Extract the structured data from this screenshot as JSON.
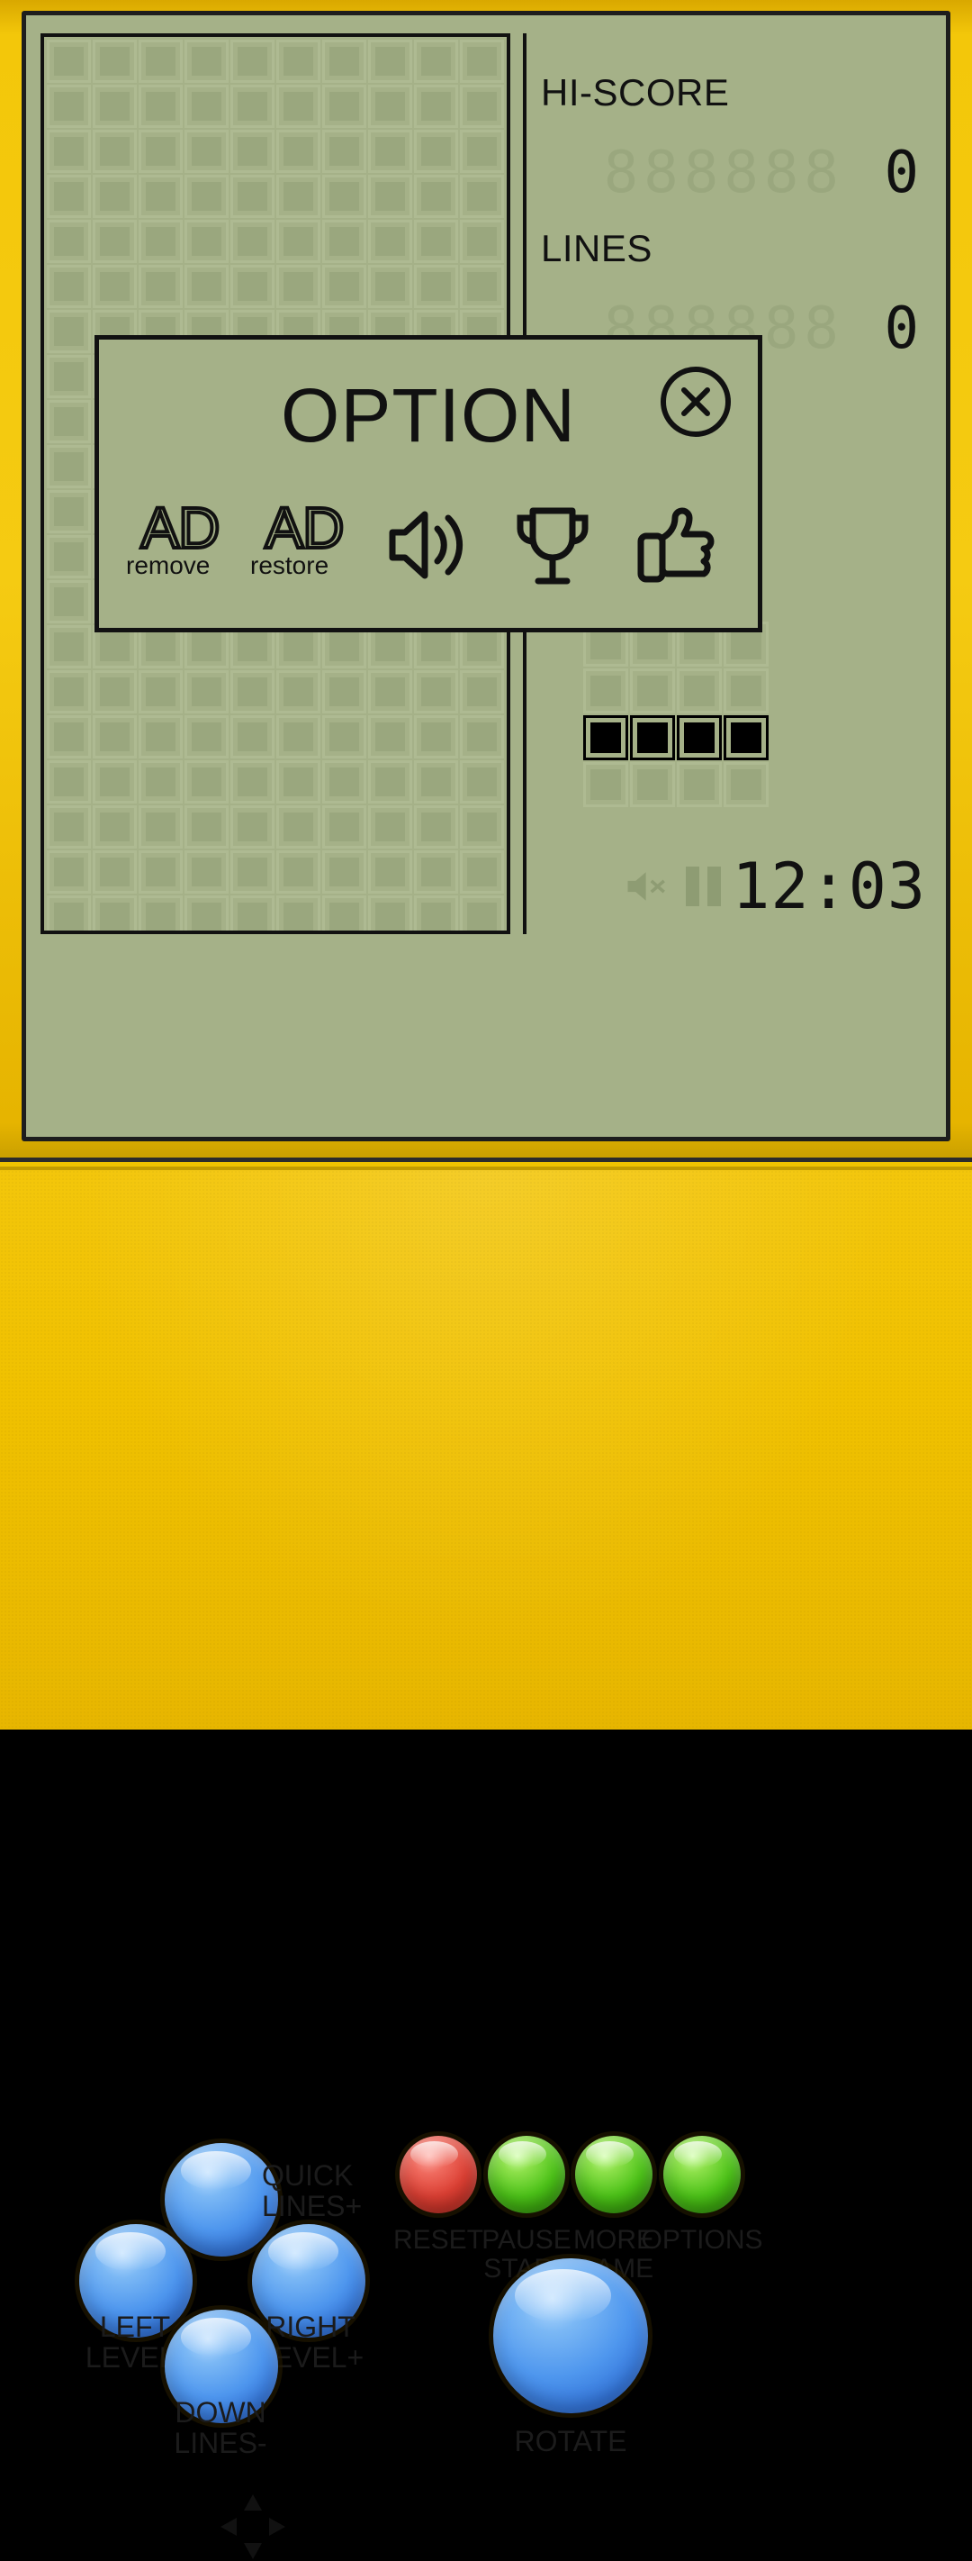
{
  "device": {
    "shell_color": "#f2c500",
    "lcd_color": "#a5b188",
    "ink_color": "#111111"
  },
  "screen": {
    "hiscore": {
      "label": "HI-SCORE",
      "ghost": "888888",
      "value": "0",
      "digits": 6
    },
    "lines": {
      "label": "LINES",
      "ghost": "888888",
      "value": "0",
      "digits": 6
    },
    "status": {
      "mute_icon": "speaker-muted-icon",
      "pause_icon": "pause-icon",
      "clock": "12:03"
    },
    "next_piece": {
      "name": "i-piece",
      "rows": 4,
      "cols": 4,
      "filled": [
        [
          0,
          0,
          0,
          0
        ],
        [
          0,
          0,
          0,
          0
        ],
        [
          1,
          1,
          1,
          1
        ],
        [
          0,
          0,
          0,
          0
        ]
      ]
    },
    "playfield": {
      "cols": 10,
      "rows": 20
    }
  },
  "dialog": {
    "title": "OPTION",
    "close_icon": "close-circle-icon",
    "options": [
      {
        "name": "ad-remove",
        "glyph": "AD",
        "caption": "remove",
        "icon": "ad-remove-icon"
      },
      {
        "name": "ad-restore",
        "glyph": "AD",
        "caption": "restore",
        "icon": "ad-restore-icon"
      },
      {
        "name": "sound",
        "glyph": "",
        "caption": "",
        "icon": "speaker-on-icon"
      },
      {
        "name": "leaderboard",
        "glyph": "",
        "caption": "",
        "icon": "trophy-icon"
      },
      {
        "name": "rate",
        "glyph": "",
        "caption": "",
        "icon": "thumbs-up-icon"
      }
    ]
  },
  "controls": {
    "dpad": {
      "up": {
        "label": "QUICK\nLINES+",
        "color": "#4f97ee"
      },
      "left": {
        "label": "LEFT\nLEVEL-",
        "color": "#4f97ee"
      },
      "right": {
        "label": "RIGHT\nLEVEL+",
        "color": "#4f97ee"
      },
      "down": {
        "label": "DOWN\nLINES-",
        "color": "#4f97ee"
      },
      "center_icon": "dpad-arrows-icon"
    },
    "buttons": [
      {
        "name": "reset",
        "label": "RESET",
        "color": "#db3f33"
      },
      {
        "name": "pause",
        "label": "PAUSE\nSTART",
        "color": "#4cc218"
      },
      {
        "name": "more",
        "label": "MORE\nGAME",
        "color": "#4cc218"
      },
      {
        "name": "options",
        "label": "OPTIONS",
        "color": "#4cc218"
      }
    ],
    "rotate": {
      "label": "ROTATE",
      "color": "#4f97ee"
    }
  }
}
